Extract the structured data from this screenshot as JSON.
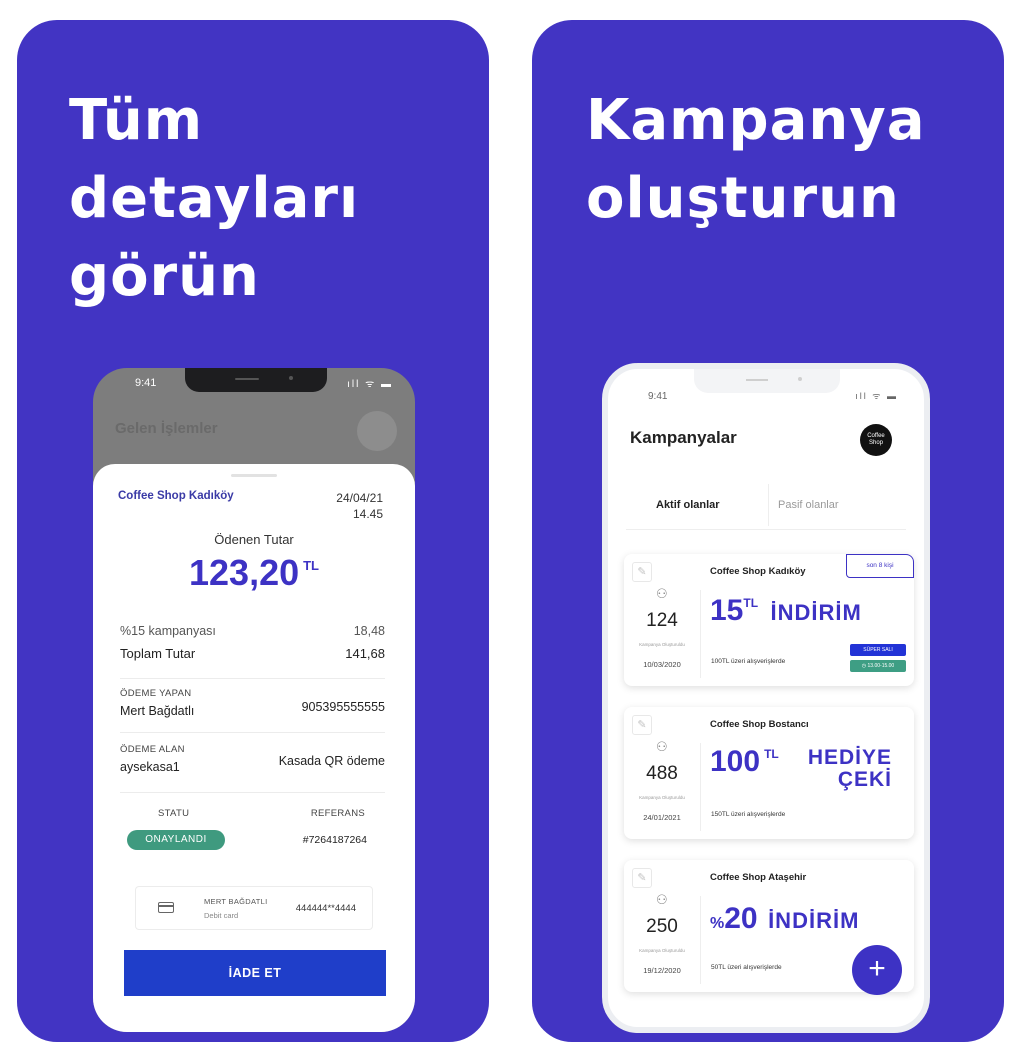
{
  "left": {
    "headline": [
      "Tüm",
      "detayları",
      "görün"
    ],
    "phone": {
      "time": "9:41",
      "signal": "ıll ᯤ ▬",
      "bg_title": "Gelen İşlemler",
      "shop": "Coffee Shop Kadıköy",
      "date": "24/04/21",
      "time_stamp": "14.45",
      "paid_label": "Ödenen Tutar",
      "amount": "123,20",
      "currency": "TL",
      "campaign_label": "%15 kampanyası",
      "campaign_value": "18,48",
      "total_label": "Toplam Tutar",
      "total_value": "141,68",
      "payer_label": "ÖDEME YAPAN",
      "payer_name": "Mert Bağdatlı",
      "payer_phone": "905395555555",
      "receiver_label": "ÖDEME ALAN",
      "receiver_name": "aysekasa1",
      "method": "Kasada QR ödeme",
      "status_label": "STATU",
      "reference_label": "REFERANS",
      "status": "ONAYLANDI",
      "reference": "#7264187264",
      "card_holder": "MERT BAĞDATLI",
      "card_type": "Debit card",
      "card_number": "444444**4444",
      "refund_button": "İADE ET"
    }
  },
  "right": {
    "headline": [
      "Kampanya",
      "oluşturun"
    ],
    "phone": {
      "time": "9:41",
      "signal": "ıll ᯤ ▬",
      "title": "Kampanyalar",
      "logo_text": "Coffee Shop",
      "tab_active": "Aktif olanlar",
      "tab_inactive": "Pasif olanlar",
      "campaigns": [
        {
          "shop": "Coffee Shop Kadıköy",
          "count": "124",
          "mini": "Kampanya Oluşturuldu",
          "date": "10/03/2020",
          "offer_value": "15",
          "offer_unit": "TL",
          "offer_text": "İNDİRİM",
          "condition": "100TL üzeri alışverişlerde",
          "tag_outline": "son 8 kişi",
          "tag_blue": "SÜPER SALI",
          "tag_green": "◷ 13.00-15.00"
        },
        {
          "shop": "Coffee Shop Bostancı",
          "count": "488",
          "mini": "Kampanya Oluşturuldu",
          "date": "24/01/2021",
          "offer_value": "100",
          "offer_unit": "TL",
          "offer_text_1": "HEDİYE",
          "offer_text_2": "ÇEKİ",
          "condition": "150TL üzeri alışverişlerde"
        },
        {
          "shop": "Coffee Shop Ataşehir",
          "count": "250",
          "mini": "Kampanya Oluşturuldu",
          "date": "19/12/2020",
          "offer_prefix": "%",
          "offer_value": "20",
          "offer_text": "İNDİRİM",
          "condition": "50TL üzeri alışverişlerde"
        }
      ],
      "fab_symbol": "+"
    }
  },
  "colors": {
    "panel": "#4234c3",
    "accent": "#3d32c4",
    "refund": "#1f3ec9",
    "status_green": "#3f9a7f"
  }
}
